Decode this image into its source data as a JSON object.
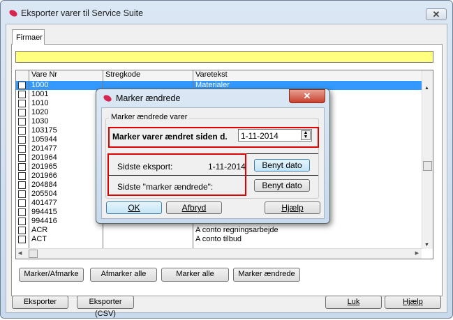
{
  "window": {
    "title": "Eksporter varer til Service Suite",
    "close": "✕"
  },
  "tab": "Firmaer",
  "grid": {
    "columns": [
      "Vare Nr",
      "Stregkode",
      "Varetekst"
    ],
    "rows": [
      {
        "nr": "1000",
        "stregkode": "",
        "tekst": "Materialer"
      },
      {
        "nr": "1001",
        "stregkode": "",
        "tekst": ""
      },
      {
        "nr": "1010",
        "stregkode": "",
        "tekst": ""
      },
      {
        "nr": "1020",
        "stregkode": "",
        "tekst": ""
      },
      {
        "nr": "1030",
        "stregkode": "",
        "tekst": ""
      },
      {
        "nr": "103175",
        "stregkode": "",
        "tekst": ""
      },
      {
        "nr": "105944",
        "stregkode": "",
        "tekst": ""
      },
      {
        "nr": "201477",
        "stregkode": "",
        "tekst": ""
      },
      {
        "nr": "201964",
        "stregkode": "",
        "tekst": ""
      },
      {
        "nr": "201965",
        "stregkode": "",
        "tekst": ""
      },
      {
        "nr": "201966",
        "stregkode": "",
        "tekst": ""
      },
      {
        "nr": "204884",
        "stregkode": "",
        "tekst": ""
      },
      {
        "nr": "205504",
        "stregkode": "",
        "tekst": ""
      },
      {
        "nr": "401477",
        "stregkode": "",
        "tekst": ""
      },
      {
        "nr": "994415",
        "stregkode": "",
        "tekst": ""
      },
      {
        "nr": "994416",
        "stregkode": "",
        "tekst": ""
      },
      {
        "nr": "ACR",
        "stregkode": "",
        "tekst": "A conto regningsarbejde"
      },
      {
        "nr": "ACT",
        "stregkode": "",
        "tekst": "A conto tilbud"
      }
    ]
  },
  "list_buttons": [
    "Marker/Afmarke",
    "Afmarker alle",
    "Marker alle",
    "Marker ændrede"
  ],
  "footer": {
    "export": "Eksporter",
    "export_csv": "Eksporter (CSV)",
    "close": "Luk",
    "help": "Hjælp"
  },
  "dialog": {
    "title": "Marker ændrede",
    "group": "Marker ændrede varer",
    "since_label": "Marker varer ændret siden d.",
    "since_value": "1-11-2014",
    "last_export_label": "Sidste eksport:",
    "last_export_value": "1-11-2014",
    "last_mark_label": "Sidste \"marker ændrede\":",
    "use_date": "Benyt dato",
    "ok": "OK",
    "cancel": "Afbryd",
    "help": "Hjælp"
  },
  "colors": {
    "selection": "#3399ff",
    "highlight": "#ffff80",
    "annotation": "#e00000"
  }
}
